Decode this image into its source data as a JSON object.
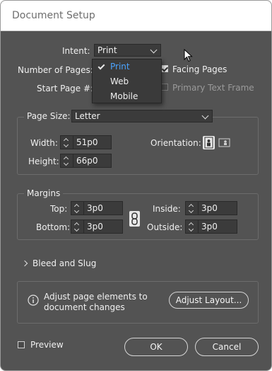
{
  "title": "Document Setup",
  "intent": {
    "label": "Intent:",
    "value": "Print",
    "options": [
      "Print",
      "Web",
      "Mobile"
    ],
    "selected_index": 0
  },
  "pages": {
    "number_label": "Number of Pages:",
    "facing_label": "Facing Pages",
    "facing_checked": true,
    "start_label": "Start Page #:",
    "primary_text_frame_label": "Primary Text Frame",
    "primary_text_frame_checked": false
  },
  "page_size": {
    "label": "Page Size:",
    "value": "Letter",
    "width_label": "Width:",
    "width": "51p0",
    "height_label": "Height:",
    "height": "66p0",
    "orientation_label": "Orientation:",
    "orientation": "portrait"
  },
  "margins": {
    "title": "Margins",
    "top_label": "Top:",
    "top": "3p0",
    "bottom_label": "Bottom:",
    "bottom": "3p0",
    "inside_label": "Inside:",
    "inside": "3p0",
    "outside_label": "Outside:",
    "outside": "3p0",
    "linked": true
  },
  "bleed_label": "Bleed and Slug",
  "info": {
    "line1": "Adjust page elements to",
    "line2": "document changes",
    "button": "Adjust Layout..."
  },
  "preview": {
    "label": "Preview",
    "checked": false
  },
  "buttons": {
    "ok": "OK",
    "cancel": "Cancel"
  },
  "colors": {
    "panel": "#535353",
    "field": "#3b3b3b",
    "selected_option": "#4aa3ff"
  },
  "icons": {
    "info": "info-icon",
    "link": "chain-link-icon",
    "portrait": "portrait-orientation-icon",
    "landscape": "landscape-orientation-icon",
    "disclosure": "chevron-right-icon",
    "cursor": "mouse-pointer-icon"
  }
}
